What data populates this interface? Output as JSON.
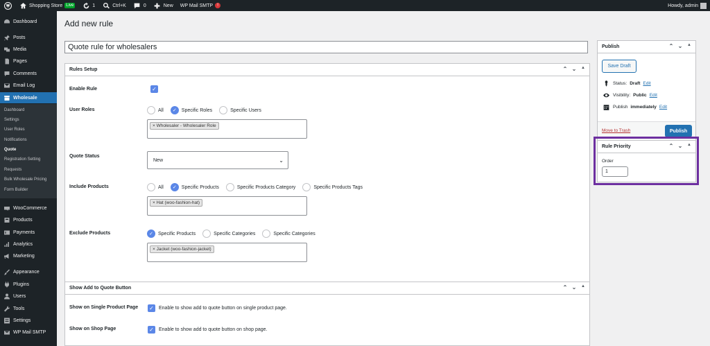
{
  "admin_bar": {
    "site_name": "Shopping Store",
    "live_badge": "Live",
    "updates_count": "1",
    "search_shortcut": "Ctrl+K",
    "comments_count": "0",
    "new_label": "New",
    "smtp_label": "WP Mail SMTP",
    "smtp_alert": "!",
    "howdy": "Howdy, admin"
  },
  "sidebar": {
    "items": [
      {
        "label": "Dashboard",
        "icon": "dashboard-icon"
      },
      {
        "label": "Posts",
        "icon": "pin-icon"
      },
      {
        "label": "Media",
        "icon": "media-icon"
      },
      {
        "label": "Pages",
        "icon": "page-icon"
      },
      {
        "label": "Comments",
        "icon": "comment-icon"
      },
      {
        "label": "Email Log",
        "icon": "email-icon"
      },
      {
        "label": "Wholesale",
        "icon": "store-icon"
      }
    ],
    "submenu": [
      "Dashboard",
      "Settings",
      "User Roles",
      "Notifications",
      "Quote",
      "Registration Setting",
      "Requests",
      "Bulk Wholesale Pricing",
      "Form Builder"
    ],
    "items2": [
      {
        "label": "WooCommerce",
        "icon": "woo-icon"
      },
      {
        "label": "Products",
        "icon": "box-icon"
      },
      {
        "label": "Payments",
        "icon": "payment-icon"
      },
      {
        "label": "Analytics",
        "icon": "chart-icon"
      },
      {
        "label": "Marketing",
        "icon": "megaphone-icon"
      },
      {
        "label": "Appearance",
        "icon": "brush-icon"
      },
      {
        "label": "Plugins",
        "icon": "plugin-icon"
      },
      {
        "label": "Users",
        "icon": "user-icon"
      },
      {
        "label": "Tools",
        "icon": "wrench-icon"
      },
      {
        "label": "Settings",
        "icon": "settings-icon"
      },
      {
        "label": "WP Mail SMTP",
        "icon": "mail-icon"
      }
    ]
  },
  "page": {
    "title": "Add new rule",
    "rule_title": "Quote rule for wholesalers"
  },
  "rules_setup": {
    "heading": "Rules Setup",
    "enable_rule": "Enable Rule",
    "user_roles": {
      "label": "User Roles",
      "options": [
        "All",
        "Specific Roles",
        "Specific Users"
      ],
      "selected": 1,
      "tags": [
        "× Wholesaler - Wholesaler Role"
      ]
    },
    "quote_status": {
      "label": "Quote Status",
      "value": "New"
    },
    "include_products": {
      "label": "Include Products",
      "options": [
        "All",
        "Specific Products",
        "Specific Products Category",
        "Specific Products Tags"
      ],
      "selected": 1,
      "tags": [
        "× Hat (woo-fashion-hat)"
      ]
    },
    "exclude_products": {
      "label": "Exclude Products",
      "options": [
        "Specific Products",
        "Specific Categories",
        "Specific Categories"
      ],
      "selected": 0,
      "tags": [
        "× Jacket (woo-fashion-jacket)"
      ]
    }
  },
  "show_quote": {
    "heading": "Show Add to Quote Button",
    "single_label": "Show on Single Product Page",
    "single_help": "Enable to show add to quote button on single product page.",
    "shop_label": "Show on Shop Page",
    "shop_help": "Enable to show add to quote button on shop page."
  },
  "publish": {
    "heading": "Publish",
    "save_draft": "Save Draft",
    "status_label": "Status:",
    "status_value": "Draft",
    "visibility_label": "Visibility:",
    "visibility_value": "Public",
    "publish_label": "Publish",
    "publish_value": "immediately",
    "edit": "Edit",
    "move_to_trash": "Move to Trash",
    "publish_button": "Publish"
  },
  "rule_priority": {
    "heading": "Rule Priority",
    "order_label": "Order",
    "order_value": "1"
  },
  "colors": {
    "admin_dark": "#1d2327",
    "accent_blue": "#2271b1",
    "checkbox_blue": "#5b87e7",
    "highlight_purple": "#6d2fa0"
  }
}
